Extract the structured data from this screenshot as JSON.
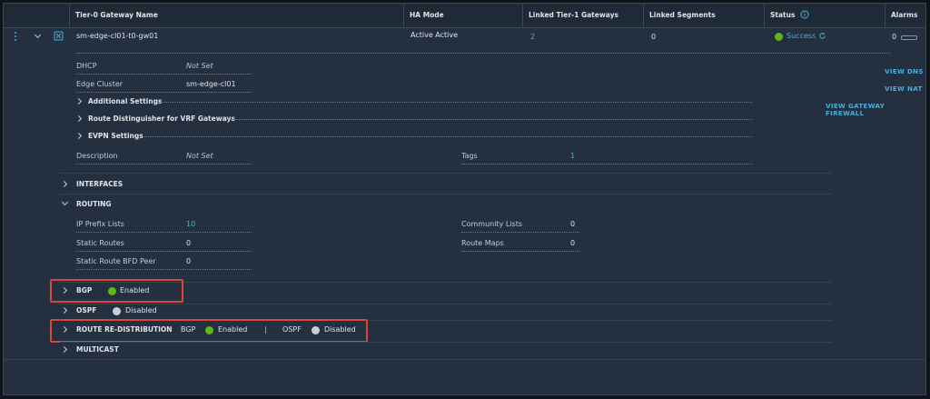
{
  "headers": [
    "Tier-0 Gateway Name",
    "HA Mode",
    "Linked Tier-1 Gateways",
    "Linked Segments",
    "Status",
    "Alarms"
  ],
  "gateway": {
    "name": "sm-edge-cl01-t0-gw01",
    "ha_mode": "Active Active",
    "linked_tier1": "2",
    "linked_segments": "0",
    "status": "Success",
    "alarms": "0"
  },
  "details": {
    "dhcp_label": "DHCP",
    "dhcp_value": "Not Set",
    "edge_label": "Edge Cluster",
    "edge_value": "sm-edge-cl01",
    "additional": "Additional Settings",
    "rd": "Route Distinguisher for VRF Gateways",
    "evpn": "EVPN Settings",
    "desc_label": "Description",
    "desc_value": "Not Set",
    "tags_label": "Tags",
    "tags_value": "1"
  },
  "actions": {
    "dns": "VIEW DNS",
    "nat": "VIEW NAT",
    "firewall": "VIEW GATEWAY FIREWALL"
  },
  "interfaces": "INTERFACES",
  "routing": {
    "title": "ROUTING",
    "ip_prefix_label": "IP Prefix Lists",
    "ip_prefix_value": "10",
    "community_label": "Community Lists",
    "community_value": "0",
    "static_label": "Static Routes",
    "static_value": "0",
    "routemaps_label": "Route Maps",
    "routemaps_value": "0",
    "bfd_label": "Static Route BFD Peer",
    "bfd_value": "0"
  },
  "bgp": {
    "label": "BGP",
    "state": "Enabled"
  },
  "ospf": {
    "label": "OSPF",
    "state": "Disabled"
  },
  "redistribution": {
    "label": "ROUTE RE-DISTRIBUTION",
    "bgp_label": "BGP",
    "bgp_state": "Enabled",
    "divider": "|",
    "ospf_label": "OSPF",
    "ospf_state": "Disabled"
  },
  "multicast": "MULTICAST",
  "colors": {
    "accent": "#49afd9",
    "success": "#5eb715",
    "highlight": "#d9473c",
    "panel": "#243040"
  },
  "icons": [
    "kebab-icon",
    "chevron-down-icon",
    "gateway-icon",
    "refresh-icon",
    "info-icon",
    "chevron-right-icon"
  ]
}
